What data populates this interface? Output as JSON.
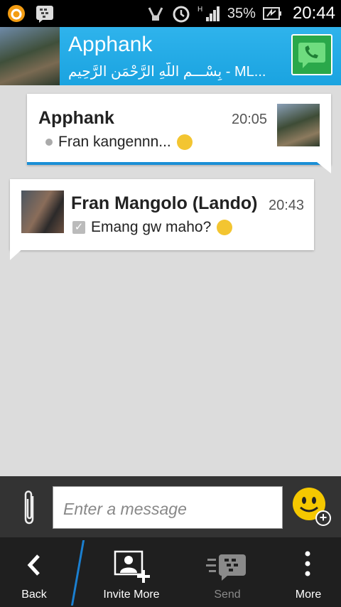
{
  "status_bar": {
    "battery_percent": "35%",
    "time": "20:44"
  },
  "header": {
    "title": "Apphank",
    "subtitle": "بِسْـــمِ اللّهِ الرَّحْمَنِ الرَّحِيم - ML..."
  },
  "messages": [
    {
      "sender": "Apphank",
      "time": "20:05",
      "text": "Fran kangennn..."
    },
    {
      "sender": "Fran Mangolo (Lando)",
      "time": "20:43",
      "text": "Emang gw maho?"
    }
  ],
  "compose": {
    "placeholder": "Enter a message"
  },
  "bottom_bar": {
    "back": "Back",
    "invite": "Invite More",
    "send": "Send",
    "more": "More"
  },
  "colors": {
    "header": "#1aa3e0",
    "accent": "#1a8fd6",
    "call_green": "#2aa84a"
  }
}
